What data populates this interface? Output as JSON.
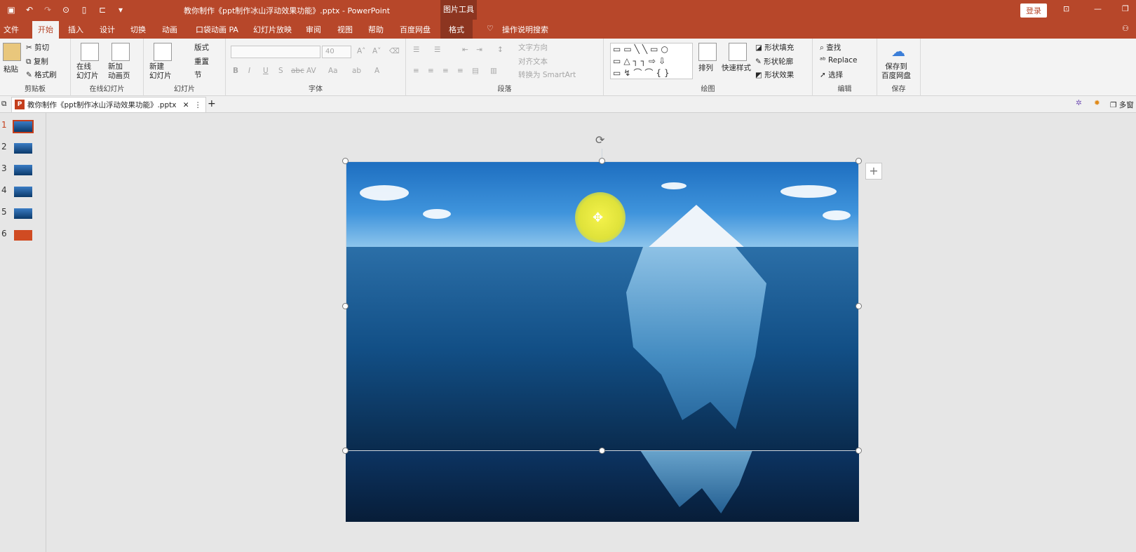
{
  "titlebar": {
    "doc_title": "教你制作《ppt制作冰山浮动效果功能》.pptx  -  PowerPoint",
    "context_group": "图片工具",
    "login": "登录"
  },
  "tabs": {
    "file": "文件",
    "home": "开始",
    "insert": "插入",
    "design": "设计",
    "transitions": "切换",
    "animations": "动画",
    "pocket": "口袋动画 PA",
    "slideshow": "幻灯片放映",
    "review": "审阅",
    "view": "视图",
    "help": "帮助",
    "baidu": "百度网盘",
    "format": "格式",
    "search": "操作说明搜索"
  },
  "clipboard": {
    "paste": "粘贴",
    "cut": "剪切",
    "copy": "复制",
    "painter": "格式刷",
    "label": "剪贴板"
  },
  "online": {
    "online_slide": "在线\n幻灯片",
    "new_anim": "新加\n动画页",
    "label": "在线幻灯片"
  },
  "slides": {
    "new_slide": "新建\n幻灯片",
    "layout": "版式",
    "reset": "重置",
    "section": "节",
    "label": "幻灯片"
  },
  "font": {
    "font_size": "40",
    "label": "字体",
    "bold": "B",
    "italic": "I",
    "underline": "U",
    "shadow": "S",
    "strike": "abc",
    "spacing": "AV",
    "case": "Aa",
    "color": "A"
  },
  "paragraph": {
    "text_dir": "文字方向",
    "align_text": "对齐文本",
    "smartart": "转换为 SmartArt",
    "label": "段落"
  },
  "drawing": {
    "shape_fill": "形状填充",
    "shape_outline": "形状轮廓",
    "shape_effect": "形状效果",
    "arrange": "排列",
    "quick_styles": "快速样式",
    "label": "绘图"
  },
  "editing": {
    "find": "查找",
    "replace": "Replace",
    "select": "选择",
    "label": "编辑"
  },
  "save": {
    "save_to": "保存到\n百度网盘",
    "label": "保存"
  },
  "doc_tab": {
    "name": "教你制作《ppt制作冰山浮动效果功能》.pptx",
    "multi_window": "多窗"
  },
  "thumbnails": [
    "1",
    "2",
    "3",
    "4",
    "5",
    "6"
  ],
  "colors": {
    "accent": "#b7472a",
    "accent_dark": "#8c3520"
  }
}
